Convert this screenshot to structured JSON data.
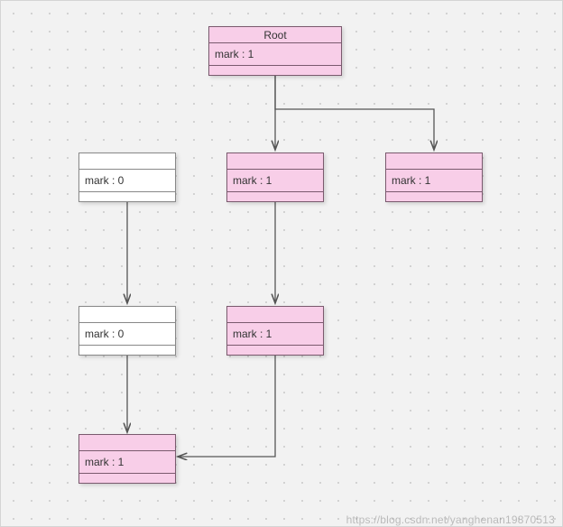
{
  "diagram": {
    "root": {
      "title": "Root",
      "attr": "mark : 1",
      "color": "#f8cee8"
    },
    "n1": {
      "title": "",
      "attr": "mark : 1",
      "color": "#f8cee8"
    },
    "n2": {
      "title": "",
      "attr": "mark : 1",
      "color": "#f8cee8"
    },
    "n3": {
      "title": "",
      "attr": "mark : 0",
      "color": "#ffffff"
    },
    "n4": {
      "title": "",
      "attr": "mark : 1",
      "color": "#f8cee8"
    },
    "n5": {
      "title": "",
      "attr": "mark : 0",
      "color": "#ffffff"
    },
    "n6": {
      "title": "",
      "attr": "mark : 1",
      "color": "#f8cee8"
    }
  },
  "edges": [
    {
      "from": "root",
      "to": "n1"
    },
    {
      "from": "root",
      "to": "n2"
    },
    {
      "from": "n1",
      "to": "n4"
    },
    {
      "from": "n3",
      "to": "n5"
    },
    {
      "from": "n5",
      "to": "n6"
    },
    {
      "from": "n4",
      "to": "n6"
    }
  ],
  "watermark": "https://blog.csdn.net/yanghenan19870513"
}
